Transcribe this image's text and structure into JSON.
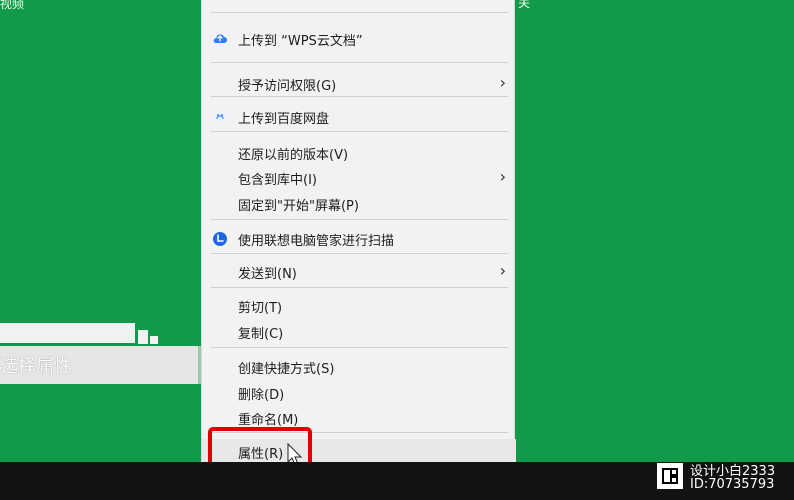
{
  "top_text": {
    "left": "视频",
    "right": "关"
  },
  "caption": {
    "text": "选择属性"
  },
  "menu": {
    "items": [
      {
        "label": "上传到 “WPS云文档”",
        "icon": "cloud-upload-icon",
        "submenu": false
      },
      {
        "label": "授予访问权限(G)",
        "icon": "",
        "submenu": true
      },
      {
        "label": "上传到百度网盘",
        "icon": "baidu-cloud-icon",
        "submenu": false
      },
      {
        "label": "还原以前的版本(V)",
        "icon": "",
        "submenu": false
      },
      {
        "label": "包含到库中(I)",
        "icon": "",
        "submenu": true
      },
      {
        "label": "固定到\"开始\"屏幕(P)",
        "icon": "",
        "submenu": false
      },
      {
        "label": "使用联想电脑管家进行扫描",
        "icon": "lenovo-icon",
        "submenu": false
      },
      {
        "label": "发送到(N)",
        "icon": "",
        "submenu": true
      },
      {
        "label": "剪切(T)",
        "icon": "",
        "submenu": false
      },
      {
        "label": "复制(C)",
        "icon": "",
        "submenu": false
      },
      {
        "label": "创建快捷方式(S)",
        "icon": "",
        "submenu": false
      },
      {
        "label": "删除(D)",
        "icon": "",
        "submenu": false
      },
      {
        "label": "重命名(M)",
        "icon": "",
        "submenu": false
      },
      {
        "label": "属性(R)",
        "icon": "",
        "submenu": false
      }
    ],
    "selected_label": "属性(R)"
  },
  "watermark": {
    "line1": "设计小白2333",
    "line2": "ID:70735793"
  },
  "colors": {
    "desktop": "#119a49",
    "menu_bg": "#f2f2f2",
    "highlight": "#e00000",
    "taskbar": "#121212"
  }
}
